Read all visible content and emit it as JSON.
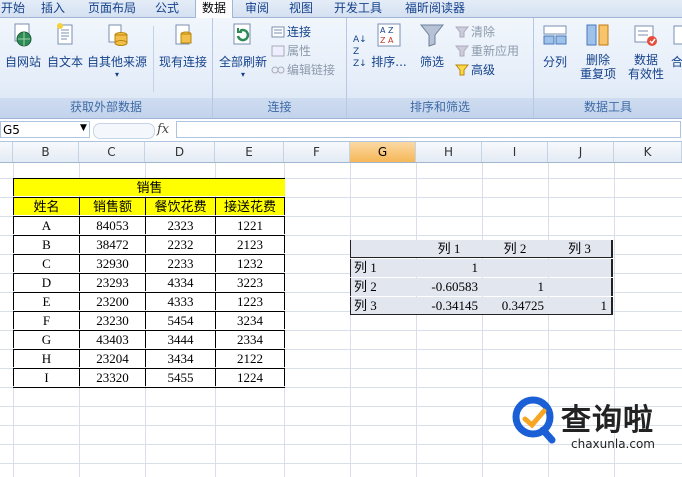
{
  "menu": {
    "tabs": [
      "开始",
      "插入",
      "页面布局",
      "公式",
      "数据",
      "审阅",
      "视图",
      "开发工具",
      "福昕阅读器"
    ],
    "active": "数据"
  },
  "ribbon": {
    "groups": [
      {
        "label": "获取外部数据",
        "buttons": [
          "自网站",
          "自文本",
          "自其他来源",
          "现有连接"
        ]
      },
      {
        "label": "连接",
        "buttons": [
          "全部刷新"
        ],
        "small": [
          "连接",
          "属性",
          "编辑链接"
        ]
      },
      {
        "label": "排序和筛选",
        "buttons": [
          "排序...",
          "筛选"
        ],
        "small": [
          "清除",
          "重新应用",
          "高级"
        ]
      },
      {
        "label": "数据工具",
        "buttons": [
          "分列",
          "删除\n重复项",
          "数据\n有效性",
          "合并"
        ]
      }
    ]
  },
  "formula_bar": {
    "name_box": "G5",
    "fx": "fx",
    "value": ""
  },
  "columns": [
    "B",
    "C",
    "D",
    "E",
    "F",
    "G",
    "H",
    "I",
    "J",
    "K"
  ],
  "selected_column": "G",
  "sales_table": {
    "title": "销售",
    "headers": [
      "姓名",
      "销售额",
      "餐饮花费",
      "接送花费"
    ],
    "rows": [
      [
        "A",
        "84053",
        "2323",
        "1221"
      ],
      [
        "B",
        "38472",
        "2232",
        "2123"
      ],
      [
        "C",
        "32930",
        "2233",
        "1232"
      ],
      [
        "D",
        "23293",
        "4334",
        "3223"
      ],
      [
        "E",
        "23200",
        "4333",
        "1223"
      ],
      [
        "F",
        "23230",
        "5454",
        "3234"
      ],
      [
        "G",
        "43403",
        "3444",
        "2334"
      ],
      [
        "H",
        "23204",
        "3434",
        "2122"
      ],
      [
        "I",
        "23320",
        "5455",
        "1224"
      ]
    ]
  },
  "correlation_table": {
    "headers": [
      "",
      "列 1",
      "列 2",
      "列 3"
    ],
    "rows": [
      [
        "列 1",
        "1",
        "",
        ""
      ],
      [
        "列 2",
        "-0.60583",
        "1",
        ""
      ],
      [
        "列 3",
        "-0.34145",
        "0.34725",
        "1"
      ]
    ]
  },
  "watermark": {
    "brand": "查询啦",
    "domain": "chaxunla.com",
    "color": "#1a5fd6"
  }
}
